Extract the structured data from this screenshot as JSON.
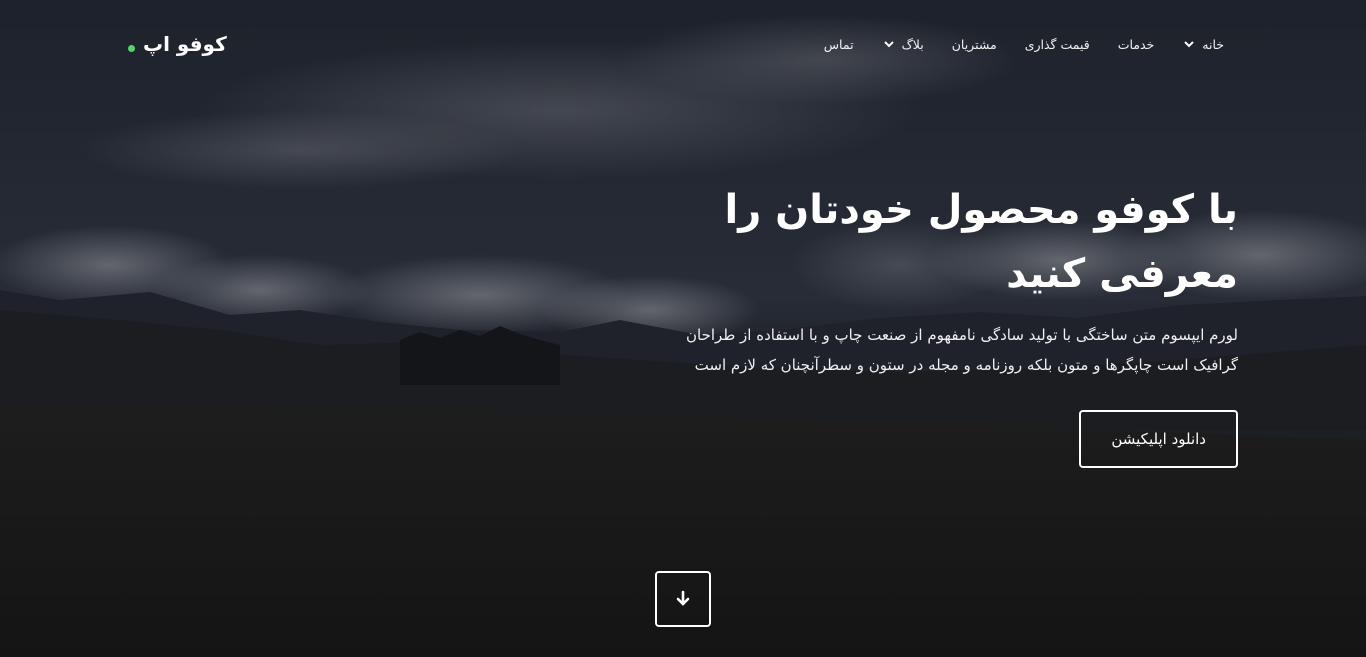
{
  "brand": {
    "name": "کوفو اپ",
    "dot_color": "#4cd964"
  },
  "nav": {
    "items": [
      {
        "label": "خانه",
        "has_dropdown": true
      },
      {
        "label": "خدمات",
        "has_dropdown": false
      },
      {
        "label": "قیمت گذاری",
        "has_dropdown": false
      },
      {
        "label": "مشتریان",
        "has_dropdown": false
      },
      {
        "label": "بلاگ",
        "has_dropdown": true
      },
      {
        "label": "تماس",
        "has_dropdown": false
      }
    ]
  },
  "hero": {
    "headline_line1": "با کوفو محصول خودتان را",
    "headline_line2": "معرفی کنید",
    "description_line1": "لورم ایپسوم متن ساختگی با تولید سادگی نامفهوم از صنعت چاپ و با استفاده از طراحان",
    "description_line2": "گرافیک است چاپگرها و متون بلکه روزنامه و مجله در ستون و سطرآنچنان که لازم است",
    "cta_label": "دانلود اپلیکیشن",
    "scroll_icon": "arrow-down-icon"
  }
}
